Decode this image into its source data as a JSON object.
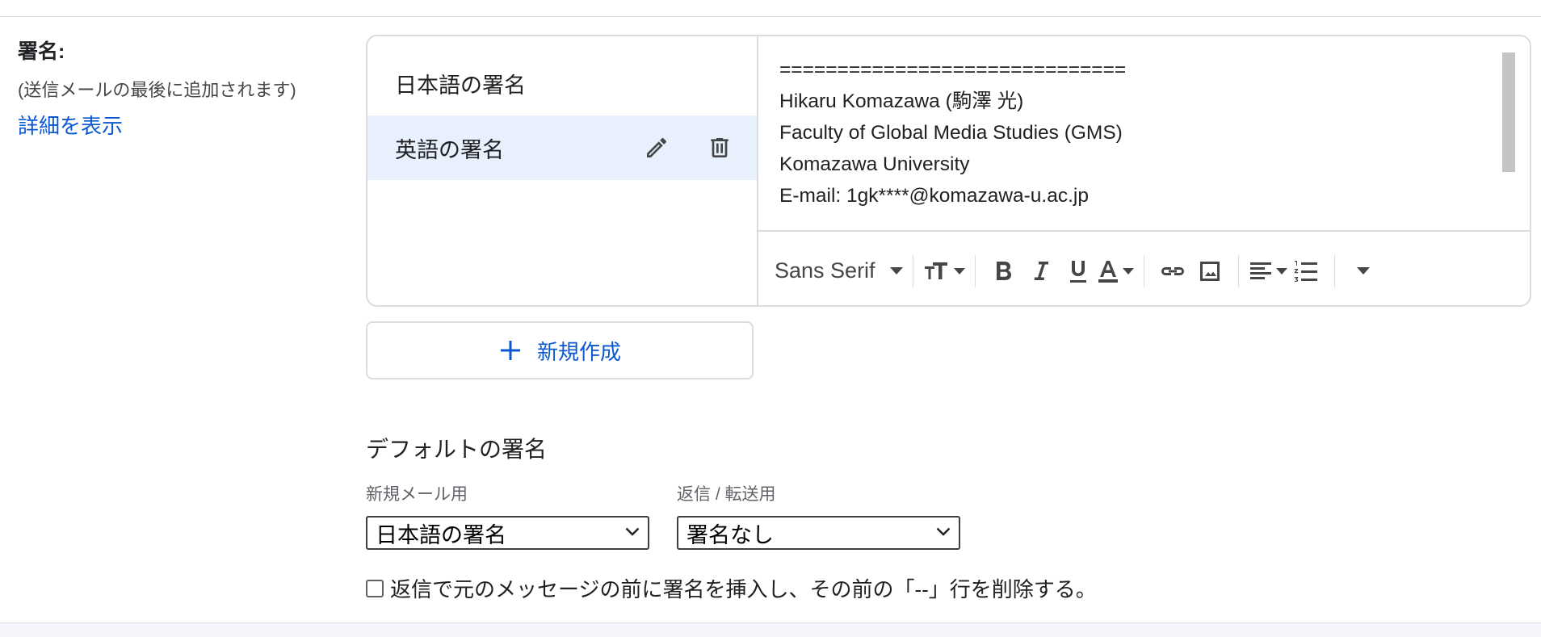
{
  "label": {
    "title": "署名:",
    "subtitle": "(送信メールの最後に追加されます)",
    "details_link": "詳細を表示"
  },
  "signatures": {
    "items": [
      {
        "name": "日本語の署名",
        "selected": false
      },
      {
        "name": "英語の署名",
        "selected": true
      }
    ]
  },
  "editor": {
    "lines": [
      "==============================",
      "Hikaru Komazawa (駒澤 光)",
      "Faculty of Global Media Studies (GMS)",
      "Komazawa University",
      "E-mail: 1gk****@komazawa-u.ac.jp"
    ]
  },
  "toolbar": {
    "font": "Sans Serif",
    "icons": [
      "font-size-icon",
      "bold-icon",
      "italic-icon",
      "underline-icon",
      "text-color-icon",
      "link-icon",
      "image-icon",
      "align-icon",
      "numbered-list-icon",
      "more-icon"
    ]
  },
  "new_button": {
    "label": "新規作成"
  },
  "defaults": {
    "title": "デフォルトの署名",
    "new_mail_label": "新規メール用",
    "new_mail_value": "日本語の署名",
    "reply_label": "返信 / 転送用",
    "reply_value": "署名なし"
  },
  "checkbox": {
    "label": "返信で元のメッセージの前に署名を挿入し、その前の「--」行を削除する。",
    "checked": false
  },
  "colors": {
    "accent": "#0b57d0",
    "selected_bg": "#e8effd",
    "border": "#dadce0"
  }
}
